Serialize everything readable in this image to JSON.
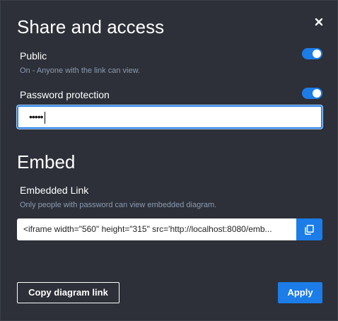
{
  "dialog": {
    "title": "Share and access",
    "close_icon": "close-icon"
  },
  "public": {
    "label": "Public",
    "hint": "On - Anyone with the link can view.",
    "enabled": true
  },
  "password": {
    "label": "Password protection",
    "enabled": true,
    "value_masked": "•••••"
  },
  "embed": {
    "section_title": "Embed",
    "label": "Embedded Link",
    "hint": "Only people with password can view embedded diagram.",
    "value": "<iframe width=\"560\" height=\"315\" src='http://localhost:8080/emb...",
    "copy_icon": "copy-icon"
  },
  "actions": {
    "copy_link_label": "Copy diagram link",
    "apply_label": "Apply"
  },
  "colors": {
    "background": "#2d3038",
    "accent": "#1c7ce8",
    "hint_text": "#8a9bb4"
  }
}
